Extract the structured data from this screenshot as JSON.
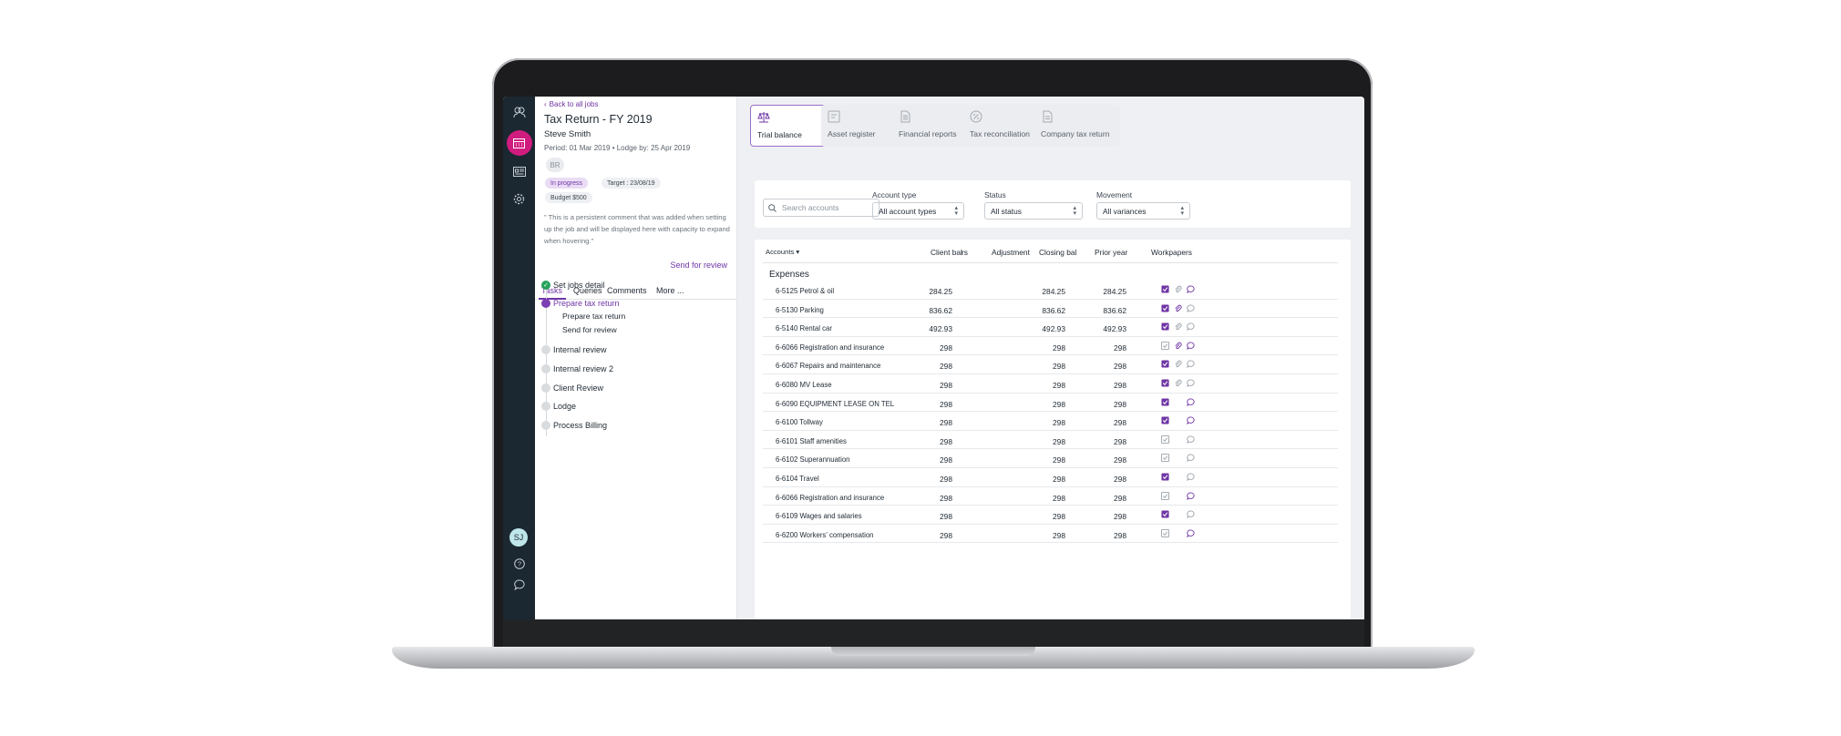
{
  "sidebar": {
    "icons": [
      "people-icon",
      "calendar-icon",
      "card-icon",
      "gear-icon",
      "help-icon",
      "chat-icon"
    ],
    "avatar": "SJ",
    "active_color": "#d01c7f"
  },
  "job": {
    "back_label": "Back to all jobs",
    "title": "Tax Return - FY 2019",
    "client": "Steve Smith",
    "period": "Period: 01 Mar 2019  •  Lodge by: 25 Apr 2019",
    "initials": "BR",
    "status": "In progress",
    "target": "Target : 23/08/19",
    "budget": "Budget $500",
    "comment": "\" This is a persistent comment that was added when setting up the job and will be displayed here with capacity to expand when hovering.\"",
    "send_review": "Send for review"
  },
  "tabs": [
    "Tasks",
    "Queries",
    "Comments",
    "More ..."
  ],
  "tasks": {
    "items": [
      "Set jobs detail",
      "Prepare tax return",
      "Internal review",
      "Internal review 2",
      "Client Review",
      "Lodge",
      "Process Billing"
    ],
    "subtasks": [
      "Prepare tax return",
      "Send for review"
    ]
  },
  "report_tabs": [
    "Trial balance",
    "Asset register",
    "Financial reports",
    "Tax reconciliation",
    "Company tax return"
  ],
  "filters": {
    "search_placeholder": "Search accounts",
    "account_type_label": "Account type",
    "account_type_value": "All account types",
    "status_label": "Status",
    "status_value": "All status",
    "movement_label": "Movement",
    "movement_value": "All variances"
  },
  "table": {
    "headers": {
      "accounts": "Accounts",
      "client_bal": "Client bal",
      "rs": "rs",
      "adjustment": "Adjustment",
      "closing_bal": "Closing bal",
      "prior_year": "Prior year",
      "workpapers": "Workpapers"
    },
    "section": "Expenses",
    "rows": [
      {
        "account": "6-5125 Petrol & oil",
        "client": "284.25",
        "closing": "284.25",
        "prior": "284.25"
      },
      {
        "account": "6-5130 Parking",
        "client": "836.62",
        "closing": "836.62",
        "prior": "836.62"
      },
      {
        "account": "6-5140 Rental car",
        "client": "492.93",
        "closing": "492.93",
        "prior": "492.93"
      },
      {
        "account": "6-6066 Registration and insurance",
        "client": "298",
        "closing": "298",
        "prior": "298"
      },
      {
        "account": "6-6067 Repairs and maintenance",
        "client": "298",
        "closing": "298",
        "prior": "298"
      },
      {
        "account": "6-6080 MV Lease",
        "client": "298",
        "closing": "298",
        "prior": "298"
      },
      {
        "account": "6-6090 EQUIPMENT LEASE ON TEL",
        "client": "298",
        "closing": "298",
        "prior": "298"
      },
      {
        "account": "6-6100 Tollway",
        "client": "298",
        "closing": "298",
        "prior": "298"
      },
      {
        "account": "6-6101 Staff amenities",
        "client": "298",
        "closing": "298",
        "prior": "298"
      },
      {
        "account": "6-6102 Superannuation",
        "client": "298",
        "closing": "298",
        "prior": "298"
      },
      {
        "account": "6-6104 Travel",
        "client": "298",
        "closing": "298",
        "prior": "298"
      },
      {
        "account": "6-6066 Registration and insurance",
        "client": "298",
        "closing": "298",
        "prior": "298"
      },
      {
        "account": "6-6109 Wages and salaries",
        "client": "298",
        "closing": "298",
        "prior": "298"
      },
      {
        "account": "6-6200 Workers' compensation",
        "client": "298",
        "closing": "298",
        "prior": "298"
      }
    ]
  },
  "colors": {
    "accent": "#6f35a5",
    "rail": "#1b2731",
    "success": "#25a35a"
  }
}
